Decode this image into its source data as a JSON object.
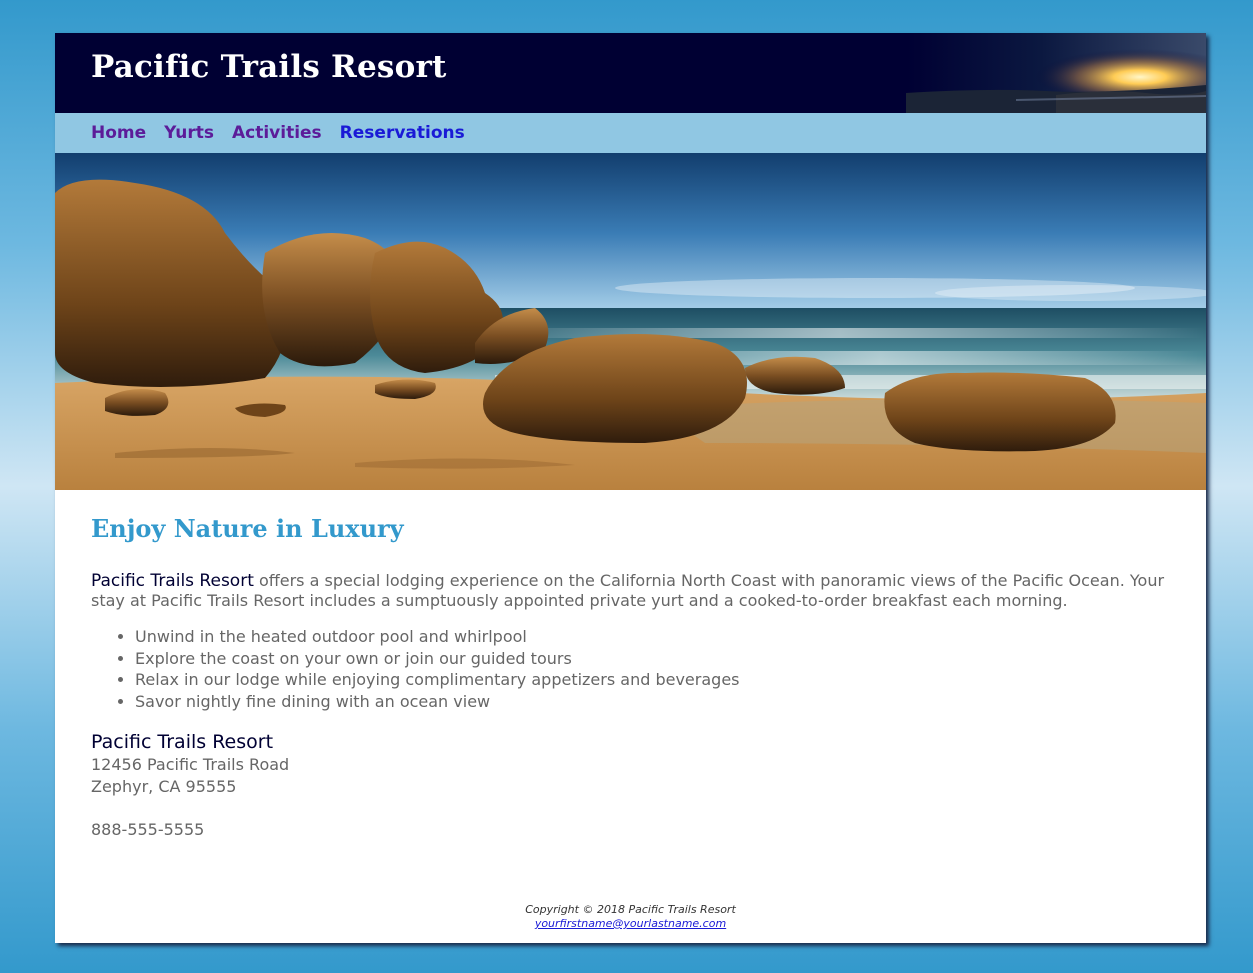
{
  "header": {
    "title": "Pacific Trails Resort"
  },
  "nav": {
    "items": [
      {
        "label": "Home"
      },
      {
        "label": "Yurts"
      },
      {
        "label": "Activities"
      },
      {
        "label": "Reservations"
      }
    ]
  },
  "hero": {
    "icon": "beach-rocks-photo"
  },
  "main": {
    "heading": "Enjoy Nature in Luxury",
    "intro_name": "Pacific Trails Resort",
    "intro_text": " offers a special lodging experience on the California North Coast with panoramic views of the Pacific Ocean. Your stay at Pacific Trails Resort includes a sumptuously appointed private yurt and a cooked-to-order breakfast each morning.",
    "features": [
      "Unwind in the heated outdoor pool and whirlpool",
      "Explore the coast on your own or join our guided tours",
      "Relax in our lodge while enjoying complimentary appetizers and beverages",
      "Savor nightly fine dining with an ocean view"
    ],
    "contact": {
      "name": "Pacific Trails Resort",
      "street": "12456 Pacific Trails Road",
      "city": "Zephyr, CA 95555",
      "phone": "888-555-5555"
    }
  },
  "footer": {
    "copyright": "Copyright © 2018 Pacific Trails Resort",
    "email": "yourfirstname@yourlastname.com"
  },
  "colors": {
    "header_bg": "#000033",
    "nav_bg": "#90c7e3",
    "heading": "#3399cc",
    "nav_link": "#5c1c99",
    "nav_link_current": "#1a1ad6",
    "body_text": "#666666"
  }
}
